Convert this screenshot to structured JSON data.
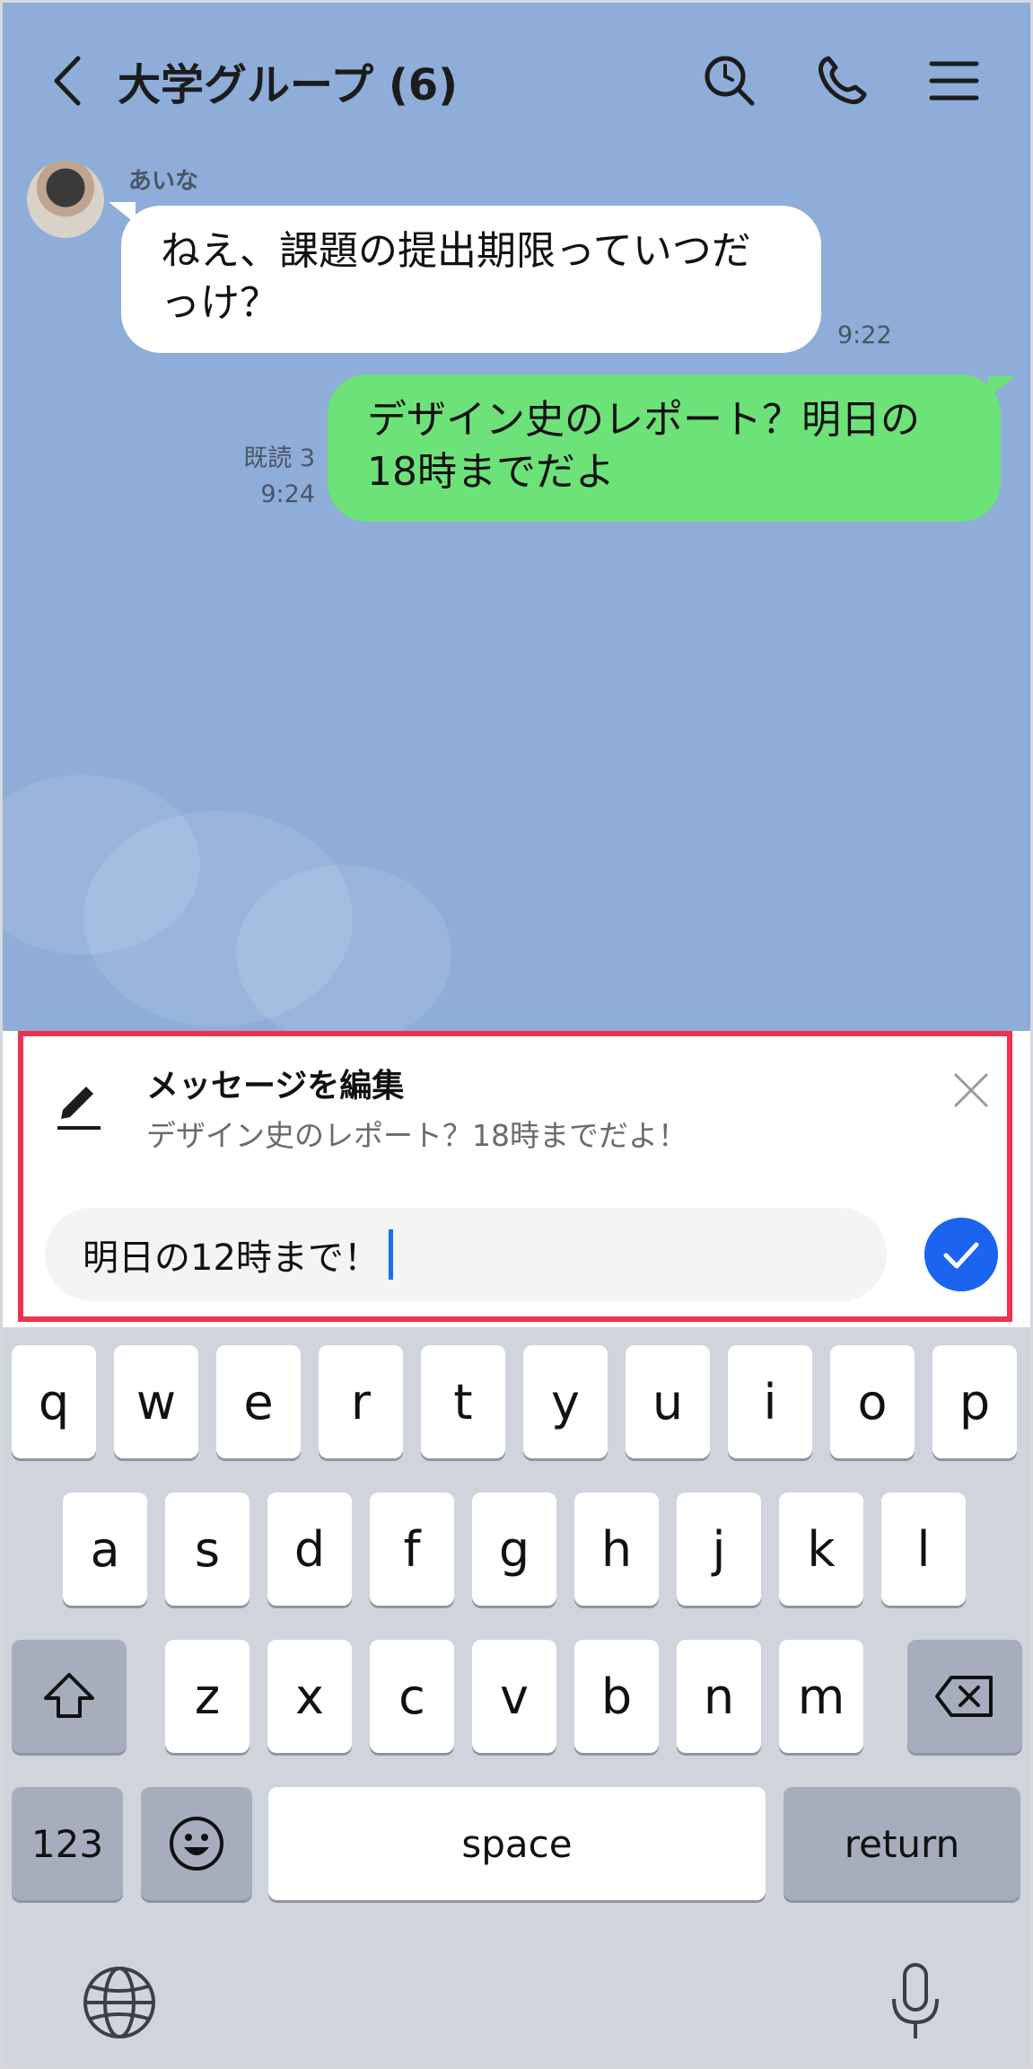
{
  "header": {
    "title": "大学グループ (6)",
    "icons": [
      "back-icon",
      "search-icon",
      "phone-icon",
      "menu-icon"
    ]
  },
  "messages": {
    "incoming": {
      "sender": "あいな",
      "text": "ねえ、課題の提出期限っていつだっけ？",
      "time": "9:22"
    },
    "outgoing": {
      "text": "デザイン史のレポート？明日の18時までだよ",
      "read": "既読 3",
      "time": "9:24"
    }
  },
  "edit": {
    "title": "メッセージを編集",
    "original": "デザイン史のレポート？18時までだよ！",
    "input_value": "明日の12時まで！"
  },
  "keyboard": {
    "row1": [
      "q",
      "w",
      "e",
      "r",
      "t",
      "y",
      "u",
      "i",
      "o",
      "p"
    ],
    "row2": [
      "a",
      "s",
      "d",
      "f",
      "g",
      "h",
      "j",
      "k",
      "l"
    ],
    "row3": [
      "z",
      "x",
      "c",
      "v",
      "b",
      "n",
      "m"
    ],
    "numbers": "123",
    "space": "space",
    "return": "return"
  },
  "colors": {
    "chat_bg": "#8eadd9",
    "outgoing_bubble": "#6de279",
    "highlight": "#f0324f",
    "send_button": "#1a64f0"
  }
}
